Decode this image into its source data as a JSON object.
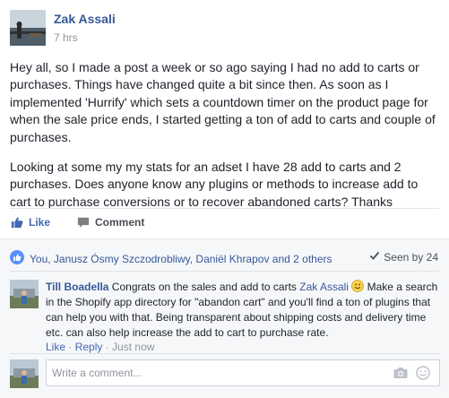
{
  "post": {
    "author": "Zak Assali",
    "time": "7 hrs",
    "paragraphs": [
      "Hey all, so I made a post a week or so ago saying I had no add to carts or purchases. Things have changed quite a bit since then. As soon as I implemented 'Hurrify' which sets a countdown timer on the product page for when the sale price ends, I started getting a ton of add to carts and couple of purchases.",
      "Looking at some my my stats for an adset I have 28 add to carts and 2 purchases. Does anyone know any plugins or methods to increase add to cart to purchase conversions or to recover abandoned carts? Thanks"
    ]
  },
  "actions": {
    "like_label": "Like",
    "comment_label": "Comment"
  },
  "reactions": {
    "summary": "You, Janusz Ósmy Szczodrobliwy, Daniël Khrapov and 2 others",
    "seen": "Seen by 24"
  },
  "comment": {
    "author": "Till Boadella",
    "text_before_tag": " Congrats on the sales and add to carts ",
    "tag": "Zak Assali",
    "text_after_tag": " Make a search in the Shopify app directory for \"abandon cart\" and you'll find a ton of plugins that can help you with that. Being transparent about shipping costs and delivery time etc. can also help increase the add to cart to purchase rate.",
    "meta": {
      "like": "Like",
      "sep1": " · ",
      "reply": "Reply",
      "sep2": " · ",
      "time": "Just now"
    }
  },
  "composer": {
    "placeholder": "Write a comment..."
  },
  "icons": {
    "like": "thumbs-up-icon",
    "comment": "speech-bubble-icon",
    "reactions": "like-badge-icon",
    "seen": "check-icon",
    "emoji": "smiley-emoji-icon",
    "camera": "camera-icon",
    "sticker": "smiley-icon"
  },
  "colors": {
    "link_blue": "#365899",
    "like_blue": "#4267b2",
    "muted": "#90949c",
    "feedback_bg": "#f6f7f9"
  }
}
